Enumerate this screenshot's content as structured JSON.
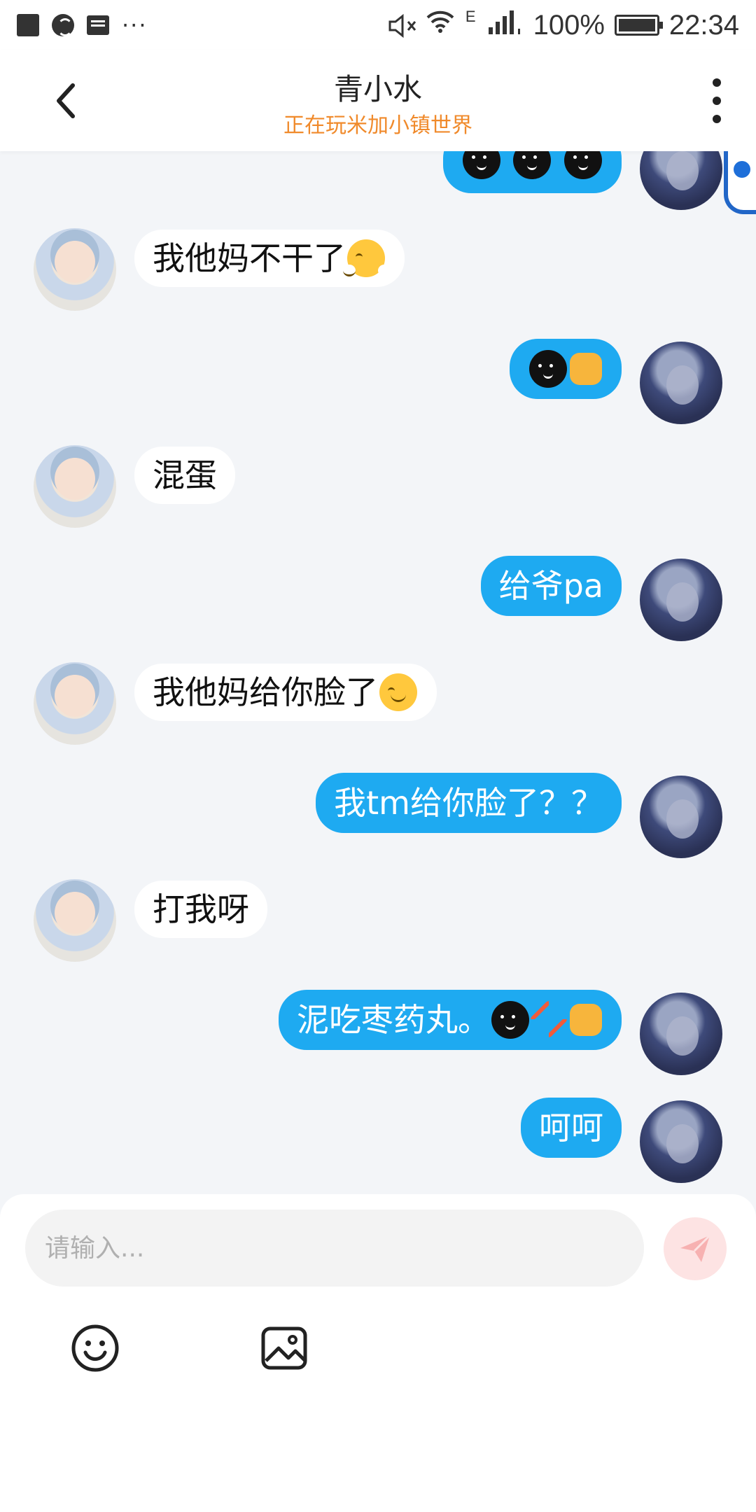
{
  "status_bar": {
    "battery": "100%",
    "time": "22:34",
    "network": "E"
  },
  "header": {
    "title": "青小水",
    "subtitle": "正在玩米加小镇世界"
  },
  "messages": [
    {
      "side": "left",
      "text": "我他妈不干了"
    },
    {
      "side": "right",
      "text": ""
    },
    {
      "side": "left",
      "text": "混蛋"
    },
    {
      "side": "right",
      "text": "给爷pa"
    },
    {
      "side": "left",
      "text": "我他妈给你脸了"
    },
    {
      "side": "right",
      "text": "我tm给你脸了？？"
    },
    {
      "side": "left",
      "text": "打我呀"
    },
    {
      "side": "right",
      "text": "泥吃枣药丸。"
    },
    {
      "side": "right",
      "text": "呵呵"
    }
  ],
  "composer": {
    "placeholder": "请输入..."
  },
  "colors": {
    "accent": "#1eaaf1",
    "subtitle": "#f08a2b"
  },
  "icons": [
    "back-arrow-icon",
    "more-vertical-icon",
    "emoji-icon",
    "image-icon",
    "send-icon"
  ]
}
